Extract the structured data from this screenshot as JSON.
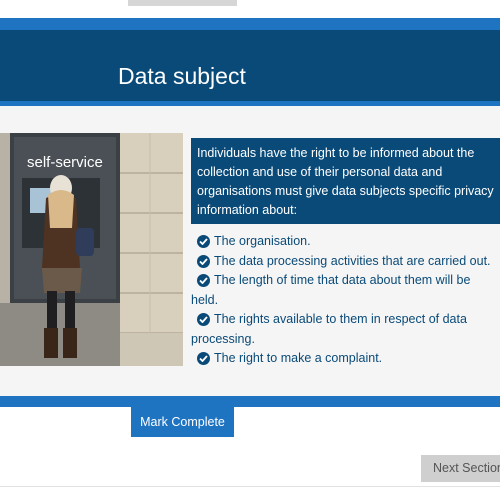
{
  "header": {
    "title": "Data subject"
  },
  "photo": {
    "sign_text": "self-service"
  },
  "info": {
    "intro": "Individuals have the right to be informed about the collection and use of their personal data and organisations must give data subjects specific privacy information about:"
  },
  "list": {
    "items": [
      "The organisation.",
      "The data processing activities that are carried out.",
      "The length of time that data about them will be held.",
      "The rights available to them in respect of data processing.",
      "The right to make a complaint."
    ]
  },
  "actions": {
    "mark_complete": "Mark Complete",
    "next_section": "Next Section"
  },
  "colors": {
    "primary": "#1f74c2",
    "dark": "#0a4a78"
  }
}
